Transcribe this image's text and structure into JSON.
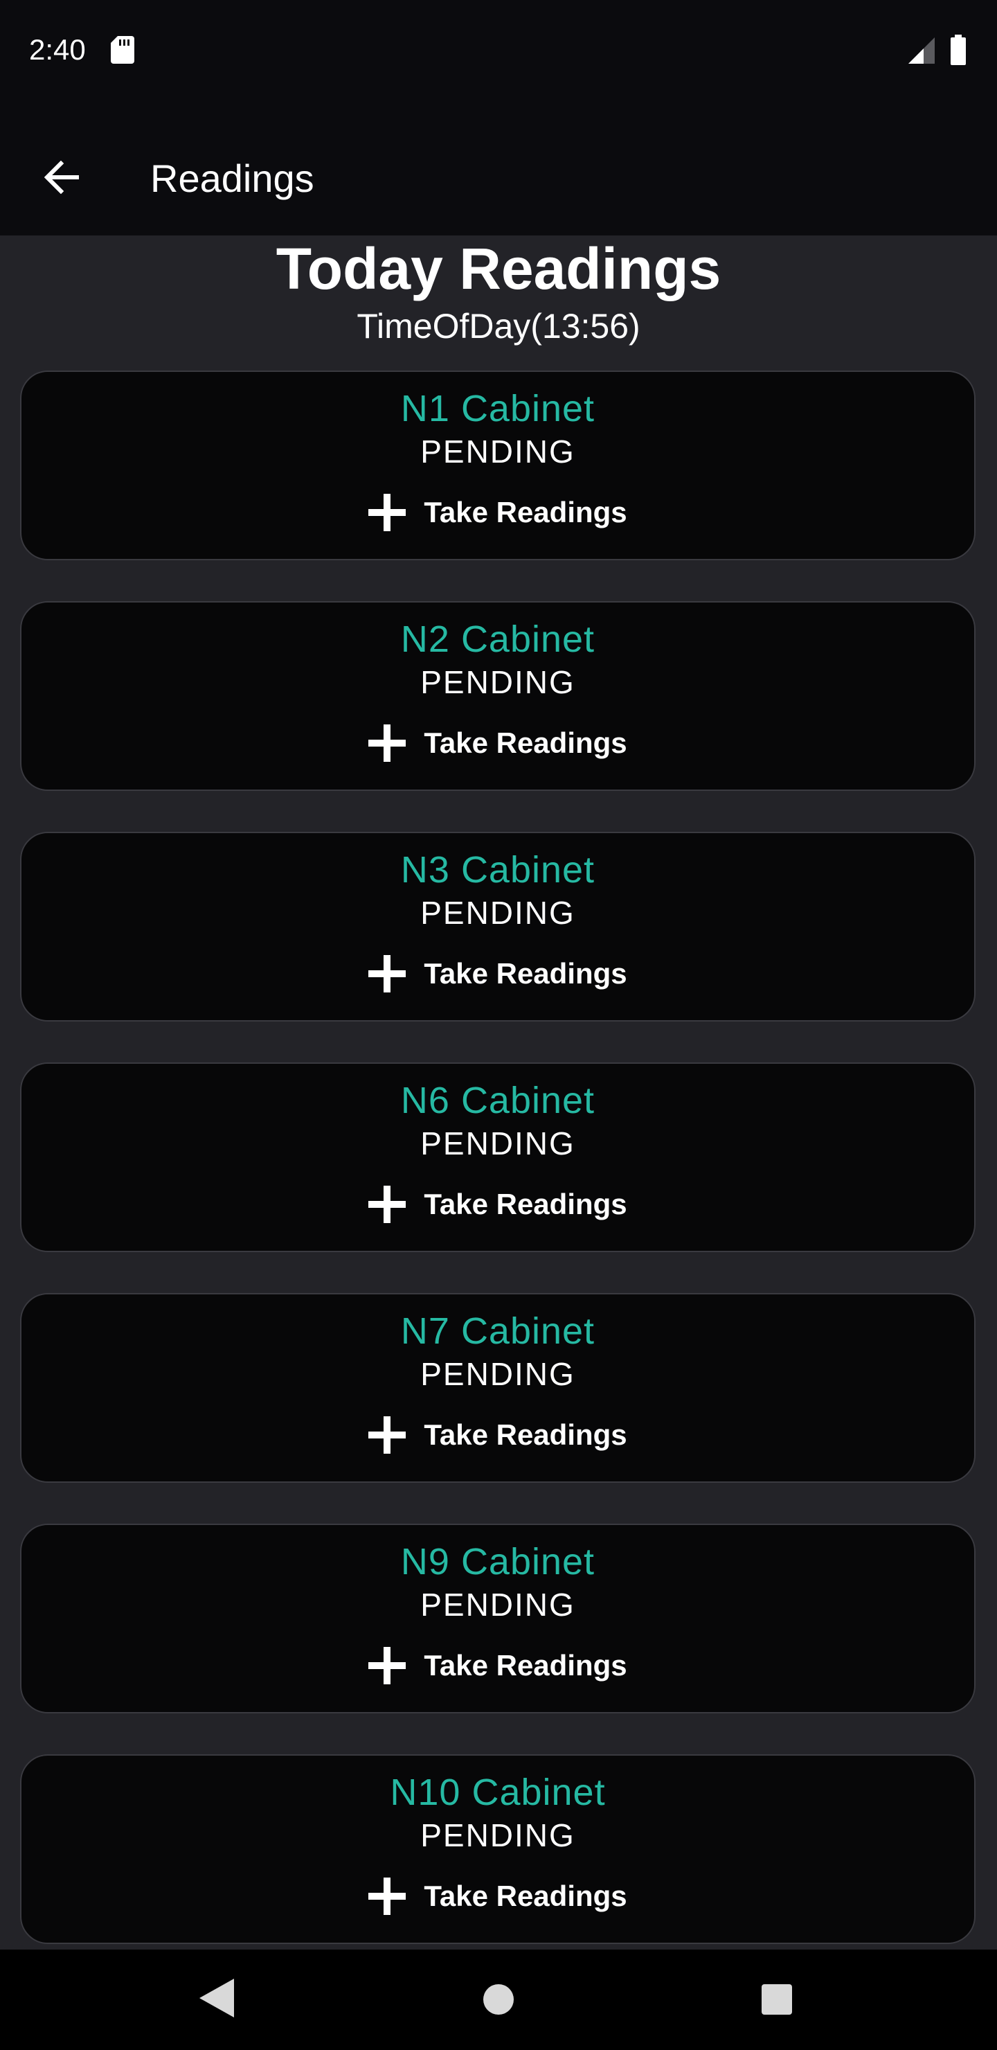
{
  "status_bar": {
    "time": "2:40"
  },
  "app_bar": {
    "title": "Readings",
    "back_icon": "arrow-left-icon"
  },
  "header": {
    "title": "Today Readings",
    "subtitle": "TimeOfDay(13:56)"
  },
  "cards": [
    {
      "name": "N1 Cabinet",
      "status": "PENDING",
      "action": "Take Readings"
    },
    {
      "name": "N2 Cabinet",
      "status": "PENDING",
      "action": "Take Readings"
    },
    {
      "name": "N3 Cabinet",
      "status": "PENDING",
      "action": "Take Readings"
    },
    {
      "name": "N6 Cabinet",
      "status": "PENDING",
      "action": "Take Readings"
    },
    {
      "name": "N7 Cabinet",
      "status": "PENDING",
      "action": "Take Readings"
    },
    {
      "name": "N9 Cabinet",
      "status": "PENDING",
      "action": "Take Readings"
    },
    {
      "name": "N10 Cabinet",
      "status": "PENDING",
      "action": "Take Readings"
    }
  ],
  "colors": {
    "accent": "#26b9a3",
    "background": "#232328",
    "card": "#070708"
  }
}
